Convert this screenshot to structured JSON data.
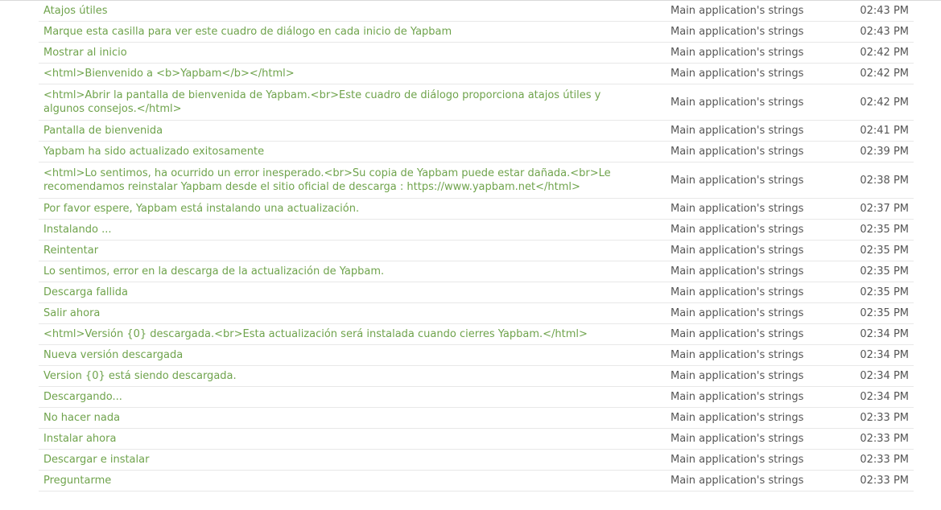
{
  "rows": [
    {
      "string": "Atajos útiles",
      "resource": "Main application's strings",
      "time": "02:43 PM"
    },
    {
      "string": "Marque esta casilla para ver este cuadro de diálogo en cada inicio de Yapbam",
      "resource": "Main application's strings",
      "time": "02:43 PM"
    },
    {
      "string": "Mostrar al inicio",
      "resource": "Main application's strings",
      "time": "02:42 PM"
    },
    {
      "string": "<html>Bienvenido a <b>Yapbam</b></html>",
      "resource": "Main application's strings",
      "time": "02:42 PM"
    },
    {
      "string": "<html>Abrir la pantalla de bienvenida de Yapbam.<br>Este cuadro de diálogo proporciona atajos útiles y algunos consejos.</html>",
      "resource": "Main application's strings",
      "time": "02:42 PM"
    },
    {
      "string": "Pantalla de bienvenida",
      "resource": "Main application's strings",
      "time": "02:41 PM"
    },
    {
      "string": "Yapbam ha sido actualizado exitosamente",
      "resource": "Main application's strings",
      "time": "02:39 PM"
    },
    {
      "string": "<html>Lo sentimos, ha ocurrido un error inesperado.<br>Su copia de Yapbam puede estar dañada.<br>Le recomendamos reinstalar Yapbam desde el sitio oficial de descarga : https://www.yapbam.net</html>",
      "resource": "Main application's strings",
      "time": "02:38 PM"
    },
    {
      "string": "Por favor espere, Yapbam está instalando una actualización.",
      "resource": "Main application's strings",
      "time": "02:37 PM"
    },
    {
      "string": "Instalando ...",
      "resource": "Main application's strings",
      "time": "02:35 PM"
    },
    {
      "string": "Reintentar",
      "resource": "Main application's strings",
      "time": "02:35 PM"
    },
    {
      "string": "Lo sentimos, error en la descarga de la actualización de Yapbam.",
      "resource": "Main application's strings",
      "time": "02:35 PM"
    },
    {
      "string": "Descarga fallida",
      "resource": "Main application's strings",
      "time": "02:35 PM"
    },
    {
      "string": "Salir ahora",
      "resource": "Main application's strings",
      "time": "02:35 PM"
    },
    {
      "string": "<html>Versión {0} descargada.<br>Esta actualización será instalada cuando cierres Yapbam.</html>",
      "resource": "Main application's strings",
      "time": "02:34 PM"
    },
    {
      "string": "Nueva versión descargada",
      "resource": "Main application's strings",
      "time": "02:34 PM"
    },
    {
      "string": "Version {0} está siendo descargada.",
      "resource": "Main application's strings",
      "time": "02:34 PM"
    },
    {
      "string": "Descargando...",
      "resource": "Main application's strings",
      "time": "02:34 PM"
    },
    {
      "string": "No hacer nada",
      "resource": "Main application's strings",
      "time": "02:33 PM"
    },
    {
      "string": "Instalar ahora",
      "resource": "Main application's strings",
      "time": "02:33 PM"
    },
    {
      "string": "Descargar e instalar",
      "resource": "Main application's strings",
      "time": "02:33 PM"
    },
    {
      "string": "Preguntarme",
      "resource": "Main application's strings",
      "time": "02:33 PM"
    }
  ]
}
